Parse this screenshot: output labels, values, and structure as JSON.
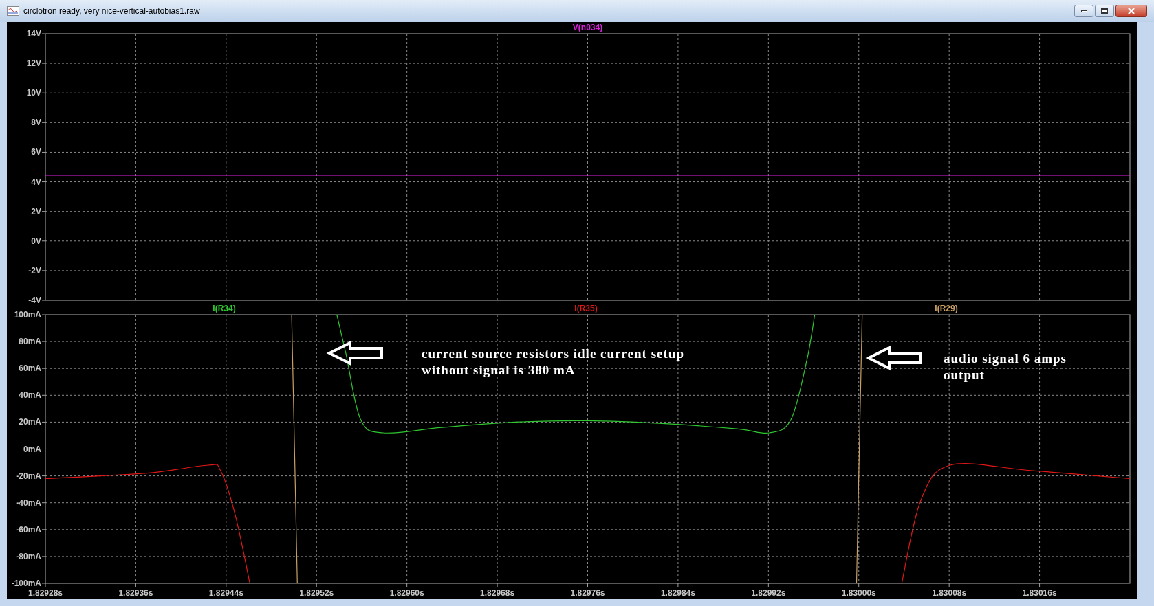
{
  "window": {
    "title": "circlotron ready, very nice-vertical-autobias1.raw"
  },
  "panes": [
    {
      "chart_data": {
        "type": "line",
        "grid": true,
        "xlim": [
          1.82928,
          1.83024
        ],
        "ylim": [
          -4,
          14
        ],
        "yticks": [
          {
            "value": 14,
            "label": "14V"
          },
          {
            "value": 12,
            "label": "12V"
          },
          {
            "value": 10,
            "label": "10V"
          },
          {
            "value": 8,
            "label": "8V"
          },
          {
            "value": 6,
            "label": "6V"
          },
          {
            "value": 4,
            "label": "4V"
          },
          {
            "value": 2,
            "label": "2V"
          },
          {
            "value": 0,
            "label": "0V"
          },
          {
            "value": -2,
            "label": "-2V"
          },
          {
            "value": -4,
            "label": "-4V"
          }
        ],
        "series": [
          {
            "name": "V(n034)",
            "color": "#e020e0",
            "x": [
              1.82928,
              1.83024
            ],
            "values": [
              4.45,
              4.45
            ]
          }
        ]
      }
    },
    {
      "chart_data": {
        "type": "line",
        "grid": true,
        "xlim": [
          1.82928,
          1.83024
        ],
        "ylim": [
          -100,
          100
        ],
        "xticks": [
          {
            "value": 1.82928,
            "label": "1.82928s"
          },
          {
            "value": 1.82936,
            "label": "1.82936s"
          },
          {
            "value": 1.82944,
            "label": "1.82944s"
          },
          {
            "value": 1.82952,
            "label": "1.82952s"
          },
          {
            "value": 1.8296,
            "label": "1.82960s"
          },
          {
            "value": 1.82968,
            "label": "1.82968s"
          },
          {
            "value": 1.82976,
            "label": "1.82976s"
          },
          {
            "value": 1.82984,
            "label": "1.82984s"
          },
          {
            "value": 1.82992,
            "label": "1.82992s"
          },
          {
            "value": 1.83,
            "label": "1.83000s"
          },
          {
            "value": 1.83008,
            "label": "1.83008s"
          },
          {
            "value": 1.83016,
            "label": "1.83016s"
          }
        ],
        "yticks": [
          {
            "value": 100,
            "label": "100mA"
          },
          {
            "value": 80,
            "label": "80mA"
          },
          {
            "value": 60,
            "label": "60mA"
          },
          {
            "value": 40,
            "label": "40mA"
          },
          {
            "value": 20,
            "label": "20mA"
          },
          {
            "value": 0,
            "label": "0mA"
          },
          {
            "value": -20,
            "label": "-20mA"
          },
          {
            "value": -40,
            "label": "-40mA"
          },
          {
            "value": -60,
            "label": "-60mA"
          },
          {
            "value": -80,
            "label": "-80mA"
          },
          {
            "value": -100,
            "label": "-100mA"
          }
        ],
        "series": [
          {
            "name": "I(R34)",
            "color": "#30c830",
            "x": [
              1.829538,
              1.829546,
              1.829559,
              1.829579,
              1.829631,
              1.829696,
              1.829759,
              1.829826,
              1.829892,
              1.829921,
              1.82994,
              1.829954,
              1.829961
            ],
            "values": [
              100,
              71,
              22,
              12,
              16,
              20,
              21,
              19,
              15,
              12,
              22,
              66,
              100
            ]
          },
          {
            "name": "I(R35)",
            "color": "#e01818",
            "x": [
              1.82928,
              1.82937,
              1.829424,
              1.829435,
              1.829448,
              1.829461,
              null,
              1.830038,
              1.830055,
              1.830081,
              1.830152,
              1.83024
            ],
            "values": [
              -22,
              -18,
              -12,
              -16,
              -49,
              -100,
              null,
              -100,
              -38,
              -12,
              -16,
              -22
            ]
          },
          {
            "name": "I(R29)",
            "color": "#c8a064",
            "x": [
              1.829498,
              1.829503,
              null,
              1.829998,
              1.830003
            ],
            "values": [
              100,
              -100,
              null,
              -100,
              100
            ]
          }
        ],
        "annotations": [
          {
            "text": "current source resistors idle current setup\nwithout signal is 380 mA"
          },
          {
            "text": "audio signal 6 amps\noutput"
          }
        ]
      }
    }
  ]
}
